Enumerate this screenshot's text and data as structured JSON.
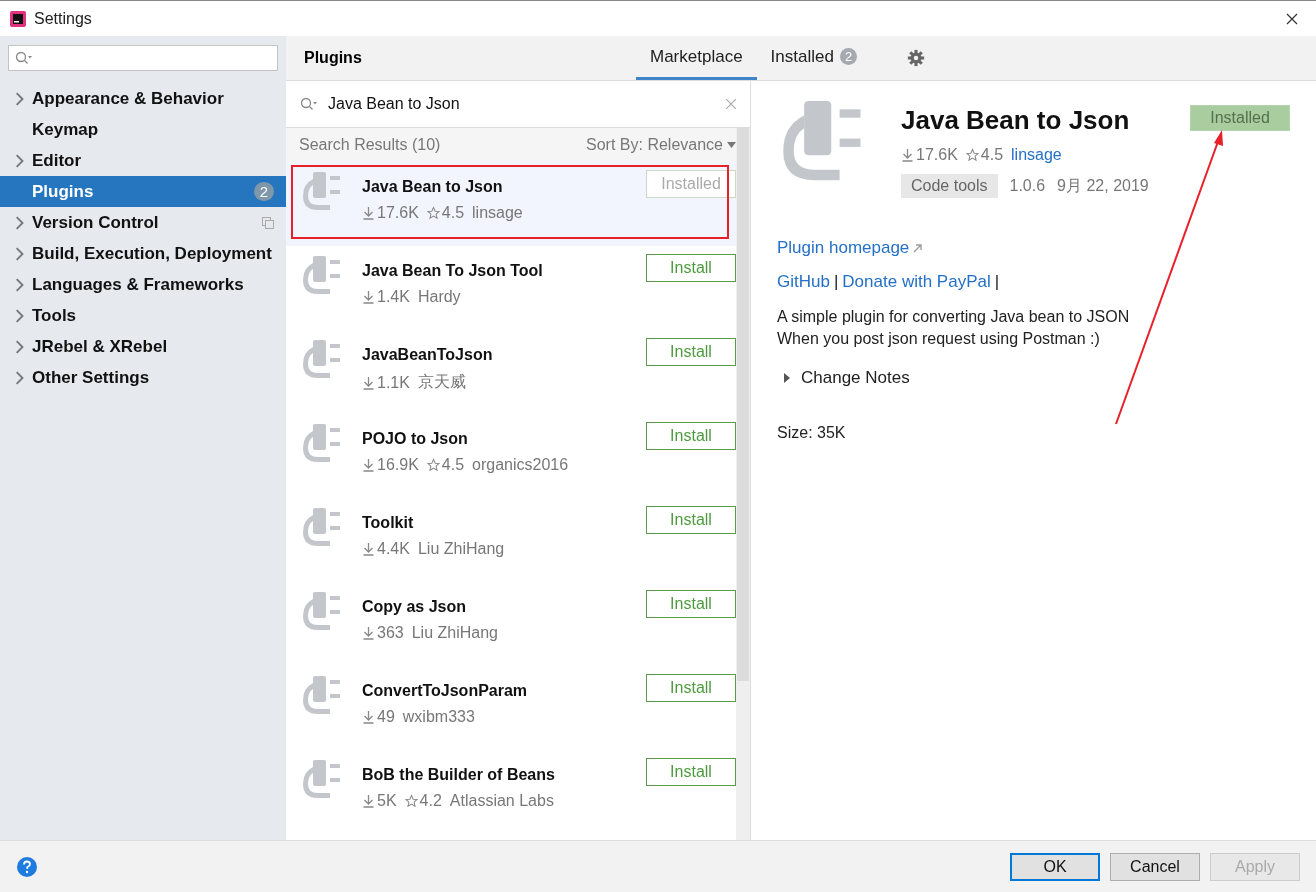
{
  "window": {
    "title": "Settings"
  },
  "sidebar": {
    "items": [
      {
        "label": "Appearance & Behavior",
        "expandable": true,
        "selected": false,
        "project_level": false
      },
      {
        "label": "Keymap",
        "expandable": false,
        "selected": false,
        "project_level": false
      },
      {
        "label": "Editor",
        "expandable": true,
        "selected": false,
        "project_level": false
      },
      {
        "label": "Plugins",
        "expandable": false,
        "selected": true,
        "project_level": false,
        "badge": "2"
      },
      {
        "label": "Version Control",
        "expandable": true,
        "selected": false,
        "project_level": true
      },
      {
        "label": "Build, Execution, Deployment",
        "expandable": true,
        "selected": false,
        "project_level": false
      },
      {
        "label": "Languages & Frameworks",
        "expandable": true,
        "selected": false,
        "project_level": false
      },
      {
        "label": "Tools",
        "expandable": true,
        "selected": false,
        "project_level": false
      },
      {
        "label": "JRebel & XRebel",
        "expandable": true,
        "selected": false,
        "project_level": false
      },
      {
        "label": "Other Settings",
        "expandable": true,
        "selected": false,
        "project_level": false
      }
    ]
  },
  "header": {
    "title": "Plugins",
    "tabs": [
      {
        "label": "Marketplace",
        "selected": true
      },
      {
        "label": "Installed",
        "selected": false,
        "badge": "2"
      }
    ]
  },
  "search": {
    "value": "Java Bean to Json"
  },
  "results": {
    "title": "Search Results (10)",
    "sort": "Sort By: Relevance",
    "items": [
      {
        "name": "Java Bean to Json",
        "downloads": "17.6K",
        "rating": "4.5",
        "author": "linsage",
        "action": "Installed",
        "installed": true,
        "selected": true
      },
      {
        "name": "Java Bean To Json Tool",
        "downloads": "1.4K",
        "author": "Hardy",
        "action": "Install",
        "installed": false,
        "selected": false
      },
      {
        "name": "JavaBeanToJson",
        "downloads": "1.1K",
        "author": "京天威",
        "action": "Install",
        "installed": false,
        "selected": false
      },
      {
        "name": "POJO to Json",
        "downloads": "16.9K",
        "rating": "4.5",
        "author": "organics2016",
        "action": "Install",
        "installed": false,
        "selected": false
      },
      {
        "name": "Toolkit",
        "downloads": "4.4K",
        "author": "Liu ZhiHang",
        "action": "Install",
        "installed": false,
        "selected": false
      },
      {
        "name": "Copy as Json",
        "downloads": "363",
        "author": "Liu ZhiHang",
        "action": "Install",
        "installed": false,
        "selected": false
      },
      {
        "name": "ConvertToJsonParam",
        "downloads": "49",
        "author": "wxibm333",
        "action": "Install",
        "installed": false,
        "selected": false
      },
      {
        "name": "BoB the Builder of Beans",
        "downloads": "5K",
        "rating": "4.2",
        "author": "Atlassian Labs",
        "action": "Install",
        "installed": false,
        "selected": false
      }
    ]
  },
  "detail": {
    "name": "Java Bean to Json",
    "action": "Installed",
    "installed": true,
    "downloads": "17.6K",
    "rating": "4.5",
    "author": "linsage",
    "tag": "Code tools",
    "version": "1.0.6",
    "date": "9月 22, 2019",
    "homepage": "Plugin homepage",
    "links": [
      "GitHub",
      "Donate with PayPal"
    ],
    "separators": [
      "|",
      "|"
    ],
    "description": [
      "A simple plugin for converting Java bean to JSON",
      "When you post json request using Postman :)"
    ],
    "change_notes": {
      "label": "Change Notes",
      "expanded": false
    },
    "size": "Size: 35K"
  },
  "buttons": [
    {
      "label": "OK",
      "kind": "default",
      "disabled": false
    },
    {
      "label": "Cancel",
      "kind": "normal",
      "disabled": false
    },
    {
      "label": "Apply",
      "kind": "normal",
      "disabled": true
    }
  ]
}
